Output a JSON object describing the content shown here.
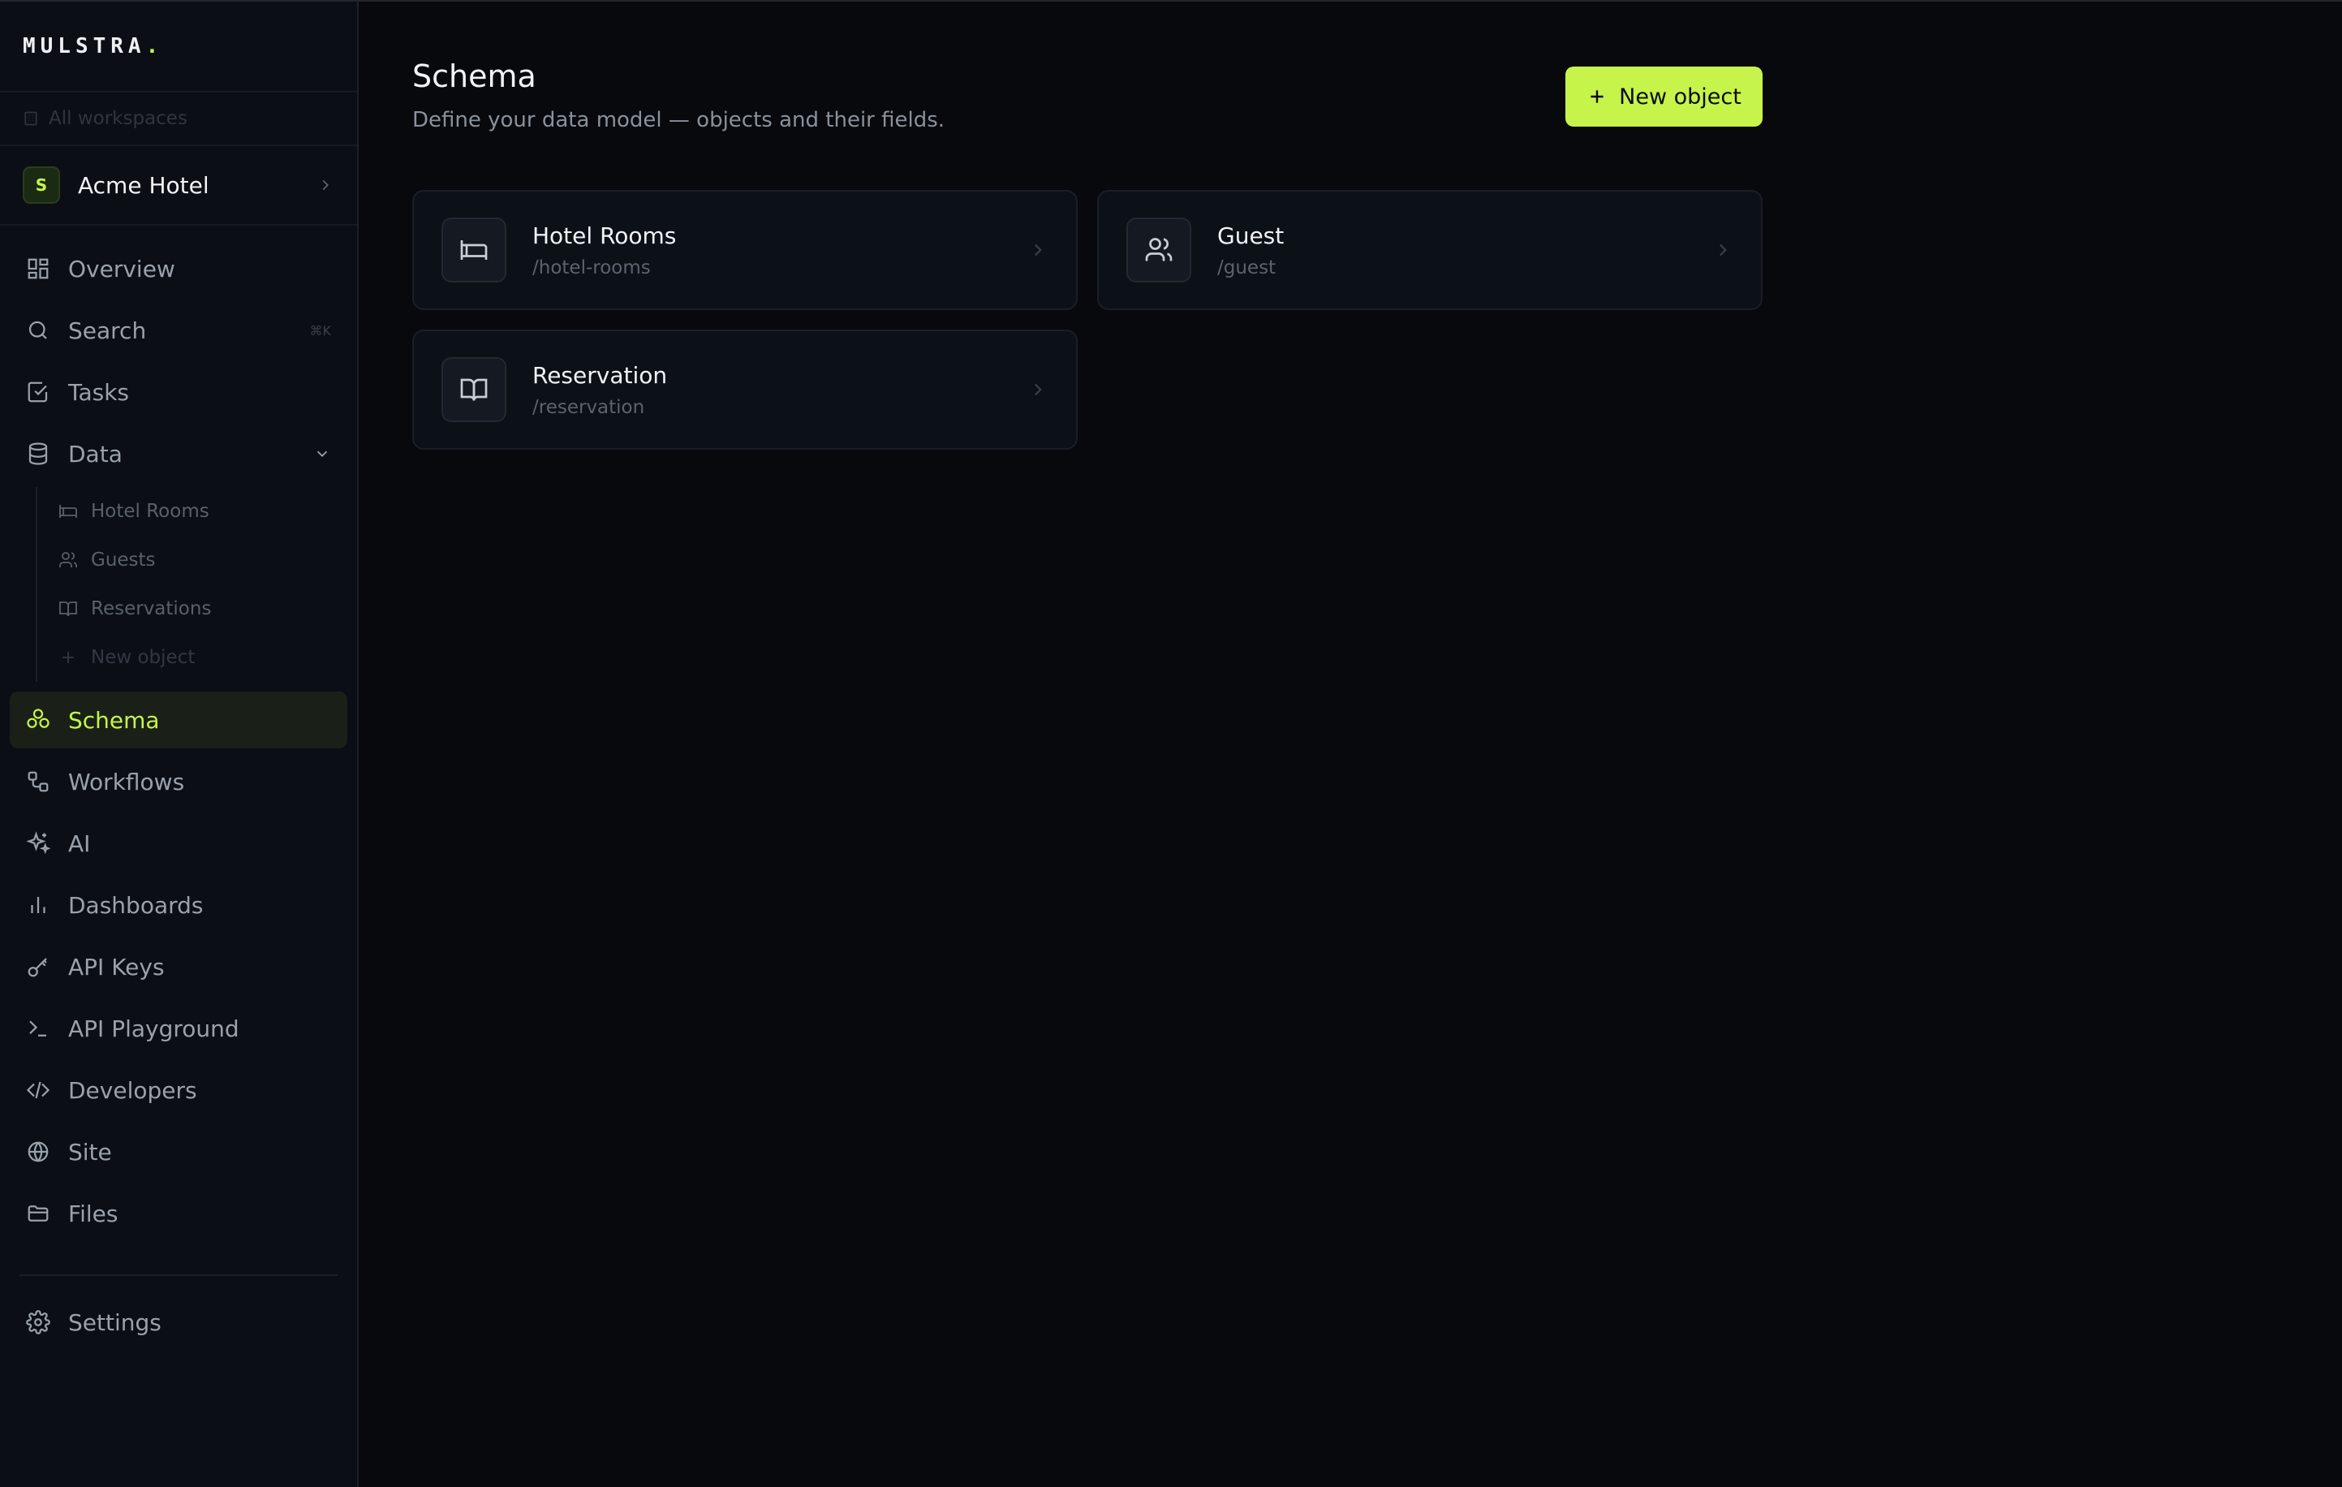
{
  "brand": {
    "name": "MULSTRA",
    "dot": "."
  },
  "sidebar": {
    "all_workspaces": "All workspaces",
    "workspace": {
      "initial": "S",
      "name": "Acme Hotel"
    },
    "items": [
      {
        "label": "Overview",
        "icon": "grid-icon"
      },
      {
        "label": "Search",
        "icon": "search-icon",
        "shortcut": "⌘K"
      },
      {
        "label": "Tasks",
        "icon": "checkbox-icon"
      },
      {
        "label": "Data",
        "icon": "database-icon"
      },
      {
        "label": "Schema",
        "icon": "schema-icon",
        "active": true
      },
      {
        "label": "Workflows",
        "icon": "workflow-icon"
      },
      {
        "label": "AI",
        "icon": "sparkles-icon"
      },
      {
        "label": "Dashboards",
        "icon": "bar-chart-icon"
      },
      {
        "label": "API Keys",
        "icon": "key-icon"
      },
      {
        "label": "API Playground",
        "icon": "terminal-icon"
      },
      {
        "label": "Developers",
        "icon": "code-icon"
      },
      {
        "label": "Site",
        "icon": "globe-icon"
      },
      {
        "label": "Files",
        "icon": "folder-icon"
      }
    ],
    "data_sub": [
      {
        "label": "Hotel Rooms",
        "icon": "bed-icon"
      },
      {
        "label": "Guests",
        "icon": "users-icon"
      },
      {
        "label": "Reservations",
        "icon": "book-icon"
      },
      {
        "label": "New object",
        "icon": "plus-icon"
      }
    ],
    "settings": {
      "label": "Settings",
      "icon": "gear-icon"
    }
  },
  "main": {
    "title": "Schema",
    "subtitle": "Define your data model — objects and their fields.",
    "new_button": "New object",
    "objects": [
      {
        "name": "Hotel Rooms",
        "slug": "/hotel-rooms",
        "icon": "bed-icon"
      },
      {
        "name": "Guest",
        "slug": "/guest",
        "icon": "users-icon"
      },
      {
        "name": "Reservation",
        "slug": "/reservation",
        "icon": "book-icon"
      }
    ]
  },
  "colors": {
    "accent": "#c6f44a",
    "background": "#07090d",
    "sidebar": "#0b0e14"
  }
}
